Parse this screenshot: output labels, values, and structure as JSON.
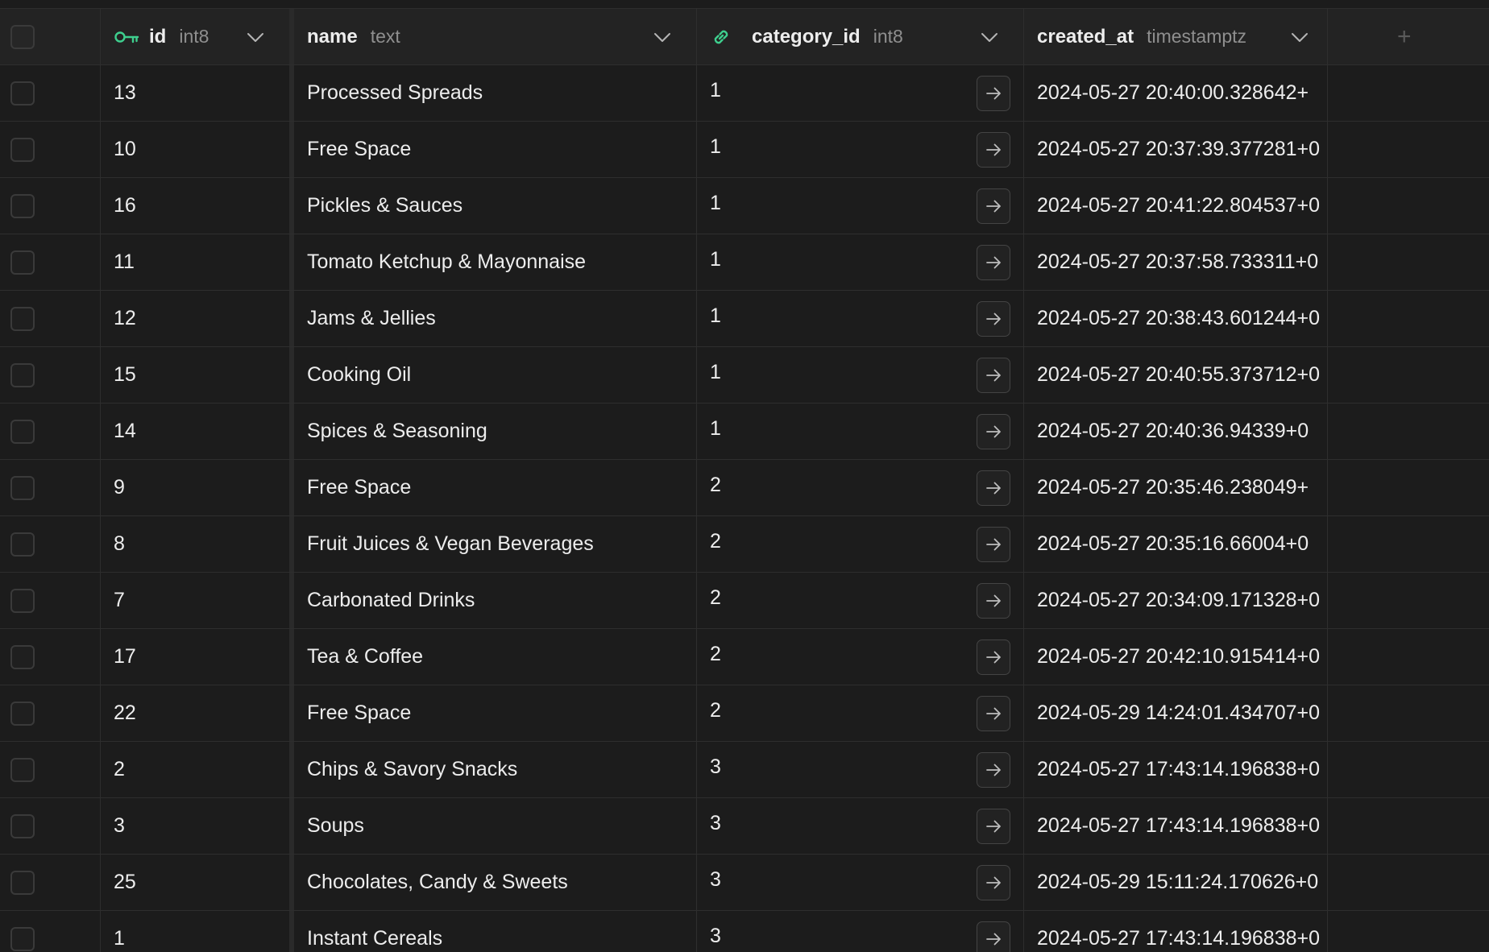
{
  "columns": {
    "id": {
      "name": "id",
      "type": "int8"
    },
    "name": {
      "name": "name",
      "type": "text"
    },
    "category_id": {
      "name": "category_id",
      "type": "int8"
    },
    "created_at": {
      "name": "created_at",
      "type": "timestamptz"
    },
    "add_label": "+"
  },
  "colors": {
    "accent": "#3ecf8e",
    "background": "#1c1c1c",
    "header_background": "#232323",
    "border": "#2e2e2e"
  },
  "icons": {
    "primary_key": "key-icon",
    "foreign_key": "link-icon",
    "sort": "chevron-down-icon",
    "open_reference": "arrow-right-icon",
    "add_column": "plus-icon"
  },
  "rows": [
    {
      "id": "13",
      "name": "Processed Spreads",
      "category_id": "1",
      "created_at": "2024-05-27 20:40:00.328642+"
    },
    {
      "id": "10",
      "name": "Free Space",
      "category_id": "1",
      "created_at": "2024-05-27 20:37:39.377281+0"
    },
    {
      "id": "16",
      "name": "Pickles & Sauces",
      "category_id": "1",
      "created_at": "2024-05-27 20:41:22.804537+0"
    },
    {
      "id": "11",
      "name": "Tomato Ketchup & Mayonnaise",
      "category_id": "1",
      "created_at": "2024-05-27 20:37:58.733311+0"
    },
    {
      "id": "12",
      "name": "Jams & Jellies",
      "category_id": "1",
      "created_at": "2024-05-27 20:38:43.601244+0"
    },
    {
      "id": "15",
      "name": "Cooking Oil",
      "category_id": "1",
      "created_at": "2024-05-27 20:40:55.373712+0"
    },
    {
      "id": "14",
      "name": "Spices & Seasoning",
      "category_id": "1",
      "created_at": "2024-05-27 20:40:36.94339+0"
    },
    {
      "id": "9",
      "name": "Free Space",
      "category_id": "2",
      "created_at": "2024-05-27 20:35:46.238049+"
    },
    {
      "id": "8",
      "name": "Fruit Juices & Vegan Beverages",
      "category_id": "2",
      "created_at": "2024-05-27 20:35:16.66004+0"
    },
    {
      "id": "7",
      "name": "Carbonated Drinks",
      "category_id": "2",
      "created_at": "2024-05-27 20:34:09.171328+0"
    },
    {
      "id": "17",
      "name": "Tea & Coffee",
      "category_id": "2",
      "created_at": "2024-05-27 20:42:10.915414+0"
    },
    {
      "id": "22",
      "name": "Free Space",
      "category_id": "2",
      "created_at": "2024-05-29 14:24:01.434707+0"
    },
    {
      "id": "2",
      "name": "Chips & Savory Snacks",
      "category_id": "3",
      "created_at": "2024-05-27 17:43:14.196838+0"
    },
    {
      "id": "3",
      "name": "Soups",
      "category_id": "3",
      "created_at": "2024-05-27 17:43:14.196838+0"
    },
    {
      "id": "25",
      "name": "Chocolates, Candy & Sweets",
      "category_id": "3",
      "created_at": "2024-05-29 15:11:24.170626+0"
    },
    {
      "id": "1",
      "name": "Instant Cereals",
      "category_id": "3",
      "created_at": "2024-05-27 17:43:14.196838+0"
    }
  ]
}
